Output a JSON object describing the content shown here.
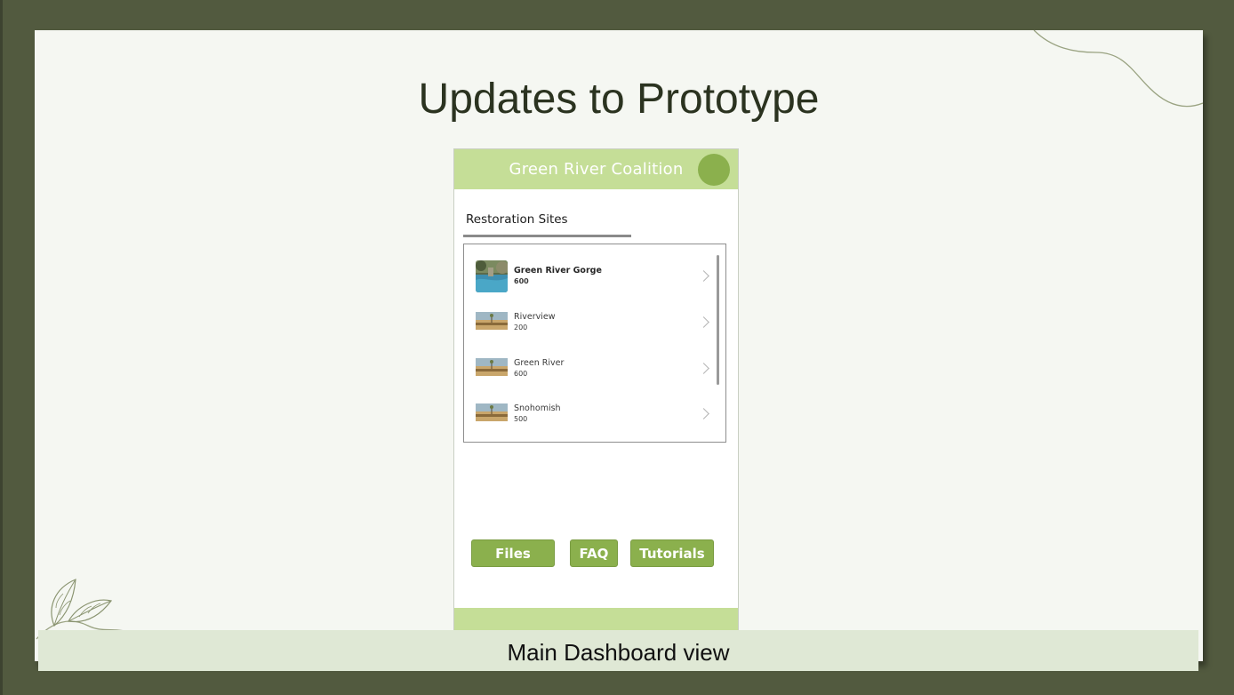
{
  "slide": {
    "title": "Updates to Prototype",
    "caption": "Main Dashboard view"
  },
  "app": {
    "title": "Green River Coalition",
    "section_title": "Restoration Sites",
    "sites": [
      {
        "name": "Green River Gorge",
        "count": "600"
      },
      {
        "name": "Riverview",
        "count": "200"
      },
      {
        "name": "Green River",
        "count": "600"
      },
      {
        "name": "Snohomish",
        "count": "500"
      }
    ],
    "buttons": {
      "files": "Files",
      "faq": "FAQ",
      "tutorials": "Tutorials"
    }
  },
  "colors": {
    "frame_background": "#525a3f",
    "slide_background": "#f5f7f2",
    "header_green": "#c5de97",
    "button_green": "#8bb04d",
    "caption_bar": "#dfe8d5"
  },
  "icons": [
    "avatar-icon",
    "chevron-right-icon",
    "leaf-branch-icon",
    "decorative-curve-icon"
  ]
}
